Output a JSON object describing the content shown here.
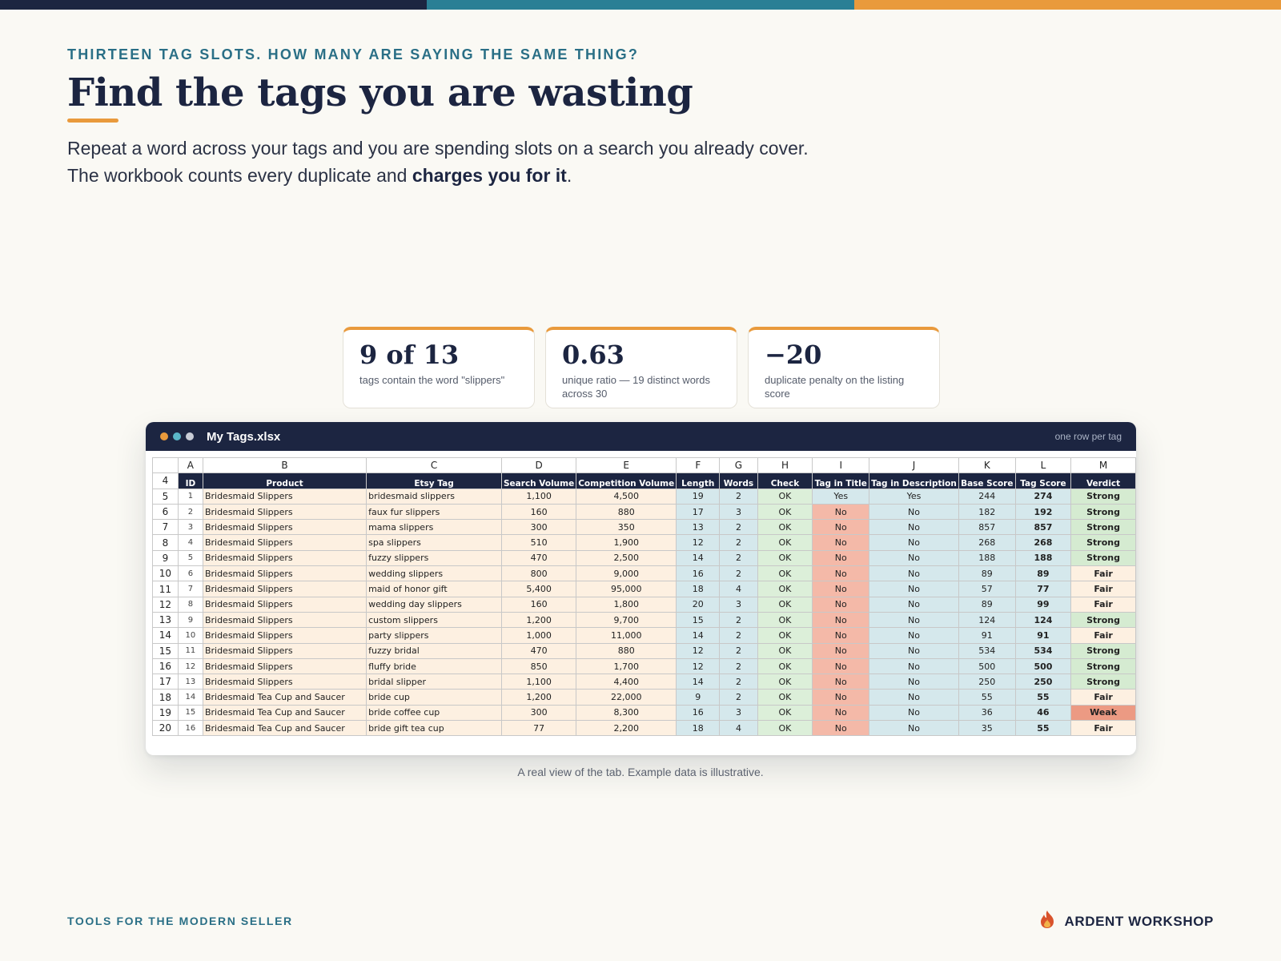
{
  "colors": {
    "navy": "#1c2541",
    "teal": "#2a7f95",
    "orange": "#e99a3c"
  },
  "header": {
    "eyebrow": "THIRTEEN TAG SLOTS. HOW MANY ARE SAYING THE SAME THING?",
    "title": "Find the tags you are wasting",
    "lede_pre": "Repeat a word across your tags and you are spending slots on a search you already cover. The workbook counts every duplicate and ",
    "lede_bold": "charges you for it",
    "lede_post": "."
  },
  "stats": [
    {
      "value": "9 of 13",
      "label": "tags contain the word \"slippers\""
    },
    {
      "value": "0.63",
      "label": "unique ratio — 19 distinct words across 30"
    },
    {
      "value": "−20",
      "label": "duplicate penalty on the listing score"
    }
  ],
  "window": {
    "title": "My Tags.xlsx",
    "note": "one row per tag",
    "col_letters": [
      "A",
      "B",
      "C",
      "D",
      "E",
      "F",
      "G",
      "H",
      "I",
      "J",
      "K",
      "L",
      "M"
    ],
    "header_row_num": "4",
    "headers": [
      "ID",
      "Product",
      "Etsy Tag",
      "Search Volume",
      "Competition Volume",
      "Length",
      "Words",
      "Check",
      "Tag in Title",
      "Tag in Description",
      "Base Score",
      "Tag Score",
      "Verdict"
    ],
    "rows": [
      {
        "n": "5",
        "cells": [
          "1",
          "Bridesmaid Slippers",
          "bridesmaid slippers",
          "1,100",
          "4,500",
          "19",
          "2",
          "OK",
          "Yes",
          "Yes",
          "244",
          "274",
          "Strong"
        ]
      },
      {
        "n": "6",
        "cells": [
          "2",
          "Bridesmaid Slippers",
          "faux fur slippers",
          "160",
          "880",
          "17",
          "3",
          "OK",
          "No",
          "No",
          "182",
          "192",
          "Strong"
        ]
      },
      {
        "n": "7",
        "cells": [
          "3",
          "Bridesmaid Slippers",
          "mama slippers",
          "300",
          "350",
          "13",
          "2",
          "OK",
          "No",
          "No",
          "857",
          "857",
          "Strong"
        ]
      },
      {
        "n": "8",
        "cells": [
          "4",
          "Bridesmaid Slippers",
          "spa slippers",
          "510",
          "1,900",
          "12",
          "2",
          "OK",
          "No",
          "No",
          "268",
          "268",
          "Strong"
        ]
      },
      {
        "n": "9",
        "cells": [
          "5",
          "Bridesmaid Slippers",
          "fuzzy slippers",
          "470",
          "2,500",
          "14",
          "2",
          "OK",
          "No",
          "No",
          "188",
          "188",
          "Strong"
        ]
      },
      {
        "n": "10",
        "cells": [
          "6",
          "Bridesmaid Slippers",
          "wedding slippers",
          "800",
          "9,000",
          "16",
          "2",
          "OK",
          "No",
          "No",
          "89",
          "89",
          "Fair"
        ]
      },
      {
        "n": "11",
        "cells": [
          "7",
          "Bridesmaid Slippers",
          "maid of honor gift",
          "5,400",
          "95,000",
          "18",
          "4",
          "OK",
          "No",
          "No",
          "57",
          "77",
          "Fair"
        ]
      },
      {
        "n": "12",
        "cells": [
          "8",
          "Bridesmaid Slippers",
          "wedding day slippers",
          "160",
          "1,800",
          "20",
          "3",
          "OK",
          "No",
          "No",
          "89",
          "99",
          "Fair"
        ]
      },
      {
        "n": "13",
        "cells": [
          "9",
          "Bridesmaid Slippers",
          "custom slippers",
          "1,200",
          "9,700",
          "15",
          "2",
          "OK",
          "No",
          "No",
          "124",
          "124",
          "Strong"
        ]
      },
      {
        "n": "14",
        "cells": [
          "10",
          "Bridesmaid Slippers",
          "party slippers",
          "1,000",
          "11,000",
          "14",
          "2",
          "OK",
          "No",
          "No",
          "91",
          "91",
          "Fair"
        ]
      },
      {
        "n": "15",
        "cells": [
          "11",
          "Bridesmaid Slippers",
          "fuzzy bridal",
          "470",
          "880",
          "12",
          "2",
          "OK",
          "No",
          "No",
          "534",
          "534",
          "Strong"
        ]
      },
      {
        "n": "16",
        "cells": [
          "12",
          "Bridesmaid Slippers",
          "fluffy bride",
          "850",
          "1,700",
          "12",
          "2",
          "OK",
          "No",
          "No",
          "500",
          "500",
          "Strong"
        ]
      },
      {
        "n": "17",
        "cells": [
          "13",
          "Bridesmaid Slippers",
          "bridal slipper",
          "1,100",
          "4,400",
          "14",
          "2",
          "OK",
          "No",
          "No",
          "250",
          "250",
          "Strong"
        ]
      },
      {
        "n": "18",
        "cells": [
          "14",
          "Bridesmaid Tea Cup and Saucer",
          "bride cup",
          "1,200",
          "22,000",
          "9",
          "2",
          "OK",
          "No",
          "No",
          "55",
          "55",
          "Fair"
        ]
      },
      {
        "n": "19",
        "cells": [
          "15",
          "Bridesmaid Tea Cup and Saucer",
          "bride coffee cup",
          "300",
          "8,300",
          "16",
          "3",
          "OK",
          "No",
          "No",
          "36",
          "46",
          "Weak"
        ]
      },
      {
        "n": "20",
        "cells": [
          "16",
          "Bridesmaid Tea Cup and Saucer",
          "bride gift tea cup",
          "77",
          "2,200",
          "18",
          "4",
          "OK",
          "No",
          "No",
          "35",
          "55",
          "Fair"
        ]
      }
    ]
  },
  "caption": "A real view of the tab. Example data is illustrative.",
  "footer": {
    "left": "TOOLS FOR THE MODERN SELLER",
    "brand": "ARDENT WORKSHOP",
    "brand_icon": "flame-icon"
  }
}
